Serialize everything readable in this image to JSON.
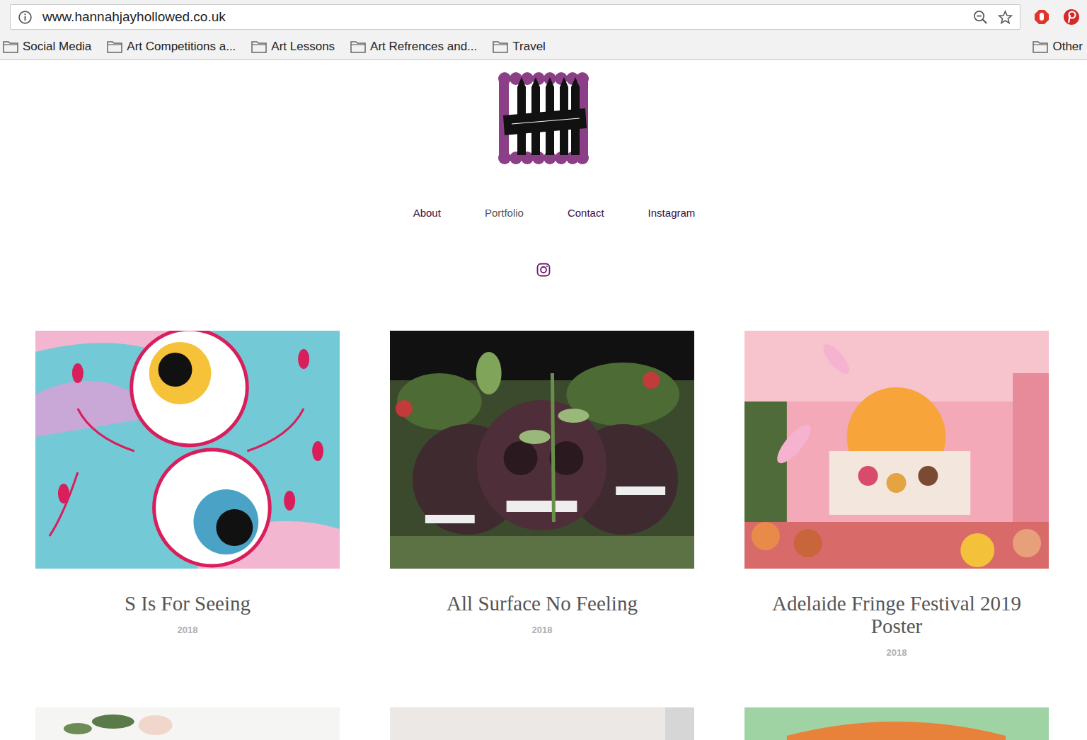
{
  "browser": {
    "url": "www.hannahjayhollowed.co.uk",
    "bookmarks": [
      {
        "label": "Social Media"
      },
      {
        "label": "Art Competitions a..."
      },
      {
        "label": "Art Lessons"
      },
      {
        "label": "Art Refrences and..."
      },
      {
        "label": "Travel"
      }
    ],
    "other_bookmarks": "Other"
  },
  "nav": [
    {
      "label": "About",
      "selected": false
    },
    {
      "label": "Portfolio",
      "selected": true
    },
    {
      "label": "Contact",
      "selected": false
    },
    {
      "label": "Instagram",
      "selected": false
    }
  ],
  "cards": [
    {
      "title": "S Is For Seeing",
      "year": "2018",
      "kind": "eyes"
    },
    {
      "title": "All Surface No Feeling",
      "year": "2018",
      "kind": "skulls"
    },
    {
      "title": "Adelaide Fringe Festival 2019 Poster",
      "year": "2018",
      "kind": "poster"
    }
  ],
  "more_cards": [
    {
      "kind": "flowers"
    },
    {
      "kind": "plain"
    },
    {
      "kind": "bowl"
    }
  ]
}
